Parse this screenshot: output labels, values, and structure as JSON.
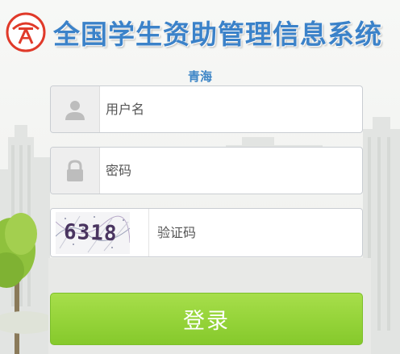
{
  "header": {
    "title": "全国学生资助管理信息系统",
    "logo": "student-aid-logo"
  },
  "region": "青海",
  "form": {
    "username": {
      "placeholder": "用户名",
      "value": "",
      "icon": "user-icon"
    },
    "password": {
      "placeholder": "密码",
      "value": "",
      "icon": "lock-icon"
    },
    "captcha": {
      "image_text": "6318",
      "placeholder": "验证码",
      "value": ""
    },
    "login_label": "登录"
  },
  "colors": {
    "title_blue": "#3b82c9",
    "region_blue": "#3d85c6",
    "button_green": "#96d43a",
    "logo_red": "#e03a2a"
  }
}
